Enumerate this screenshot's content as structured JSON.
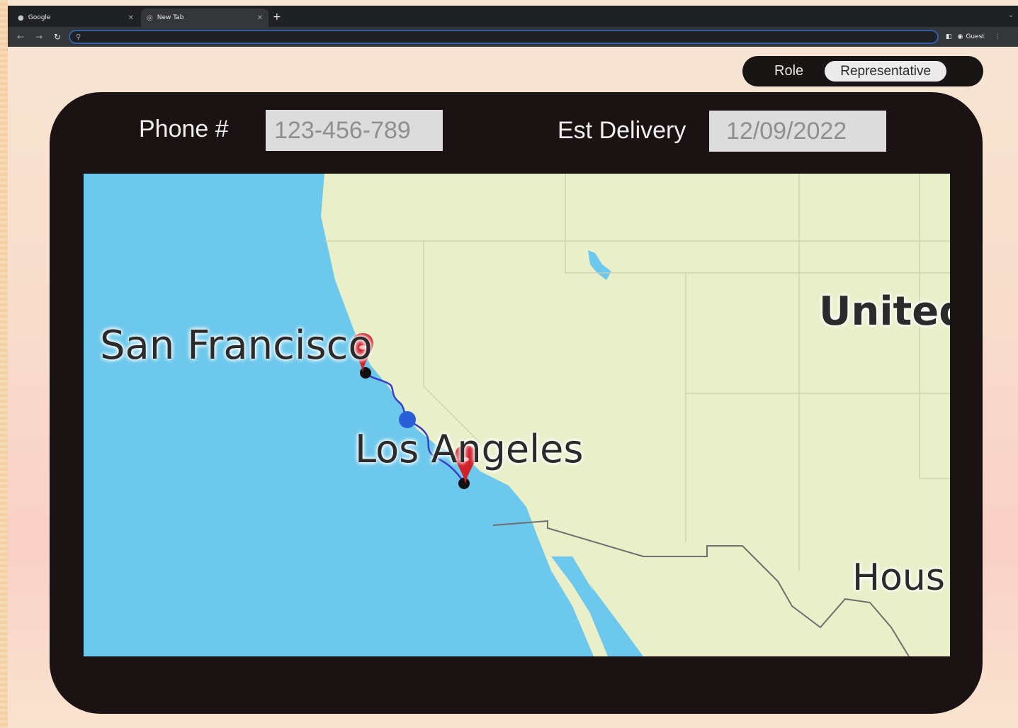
{
  "browser": {
    "tabs": [
      {
        "label": "Google",
        "active": false
      },
      {
        "label": "New Tab",
        "active": true
      }
    ],
    "new_tab_symbol": "+",
    "address_value": "",
    "profile_label": "Guest"
  },
  "role": {
    "label": "Role",
    "value": "Representative"
  },
  "form": {
    "phone_label": "Phone #",
    "phone_value": "123-456-789",
    "delivery_label": "Est Delivery",
    "delivery_value": "12/09/2022"
  },
  "map": {
    "labels": {
      "san_francisco": "San Francisco",
      "los_angeles": "Los Angeles",
      "united": "United",
      "houston": "Hous"
    },
    "colors": {
      "water": "#6cc8ec",
      "land": "#e9efc8",
      "route": "#3a3fc9",
      "marker": "#d0202a",
      "current_position": "#2a5fd8"
    },
    "icons": [
      "map-pin-icon",
      "route-position-icon"
    ]
  }
}
